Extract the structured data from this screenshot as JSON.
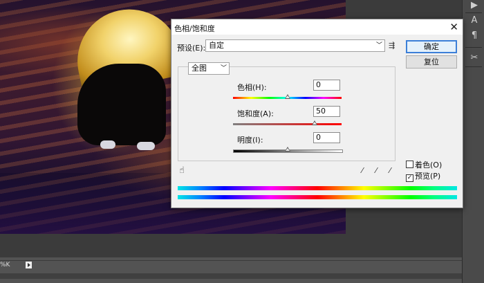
{
  "dialog": {
    "title": "色相/饱和度",
    "close_glyph": "✕",
    "preset_label": "预设(E):",
    "preset_value": "自定",
    "preset_menu_glyph": "⇶",
    "channel_value": "全图",
    "ok_label": "确定",
    "reset_label": "复位",
    "colorize_label": "着色(O)",
    "preview_label": "预览(P)",
    "preview_checked": true,
    "colorize_checked": false
  },
  "sliders": [
    {
      "label": "色相(H):",
      "value": "0",
      "fraction": 0.5,
      "track": "hue"
    },
    {
      "label": "饱和度(A):",
      "value": "50",
      "fraction": 0.75,
      "track": "saturation"
    },
    {
      "label": "明度(I):",
      "value": "0",
      "fraction": 0.5,
      "track": "lightness"
    }
  ],
  "status": {
    "zoom_text": "%K"
  },
  "icons": {
    "hand": "hand-icon",
    "eyedroppers": [
      "eyedropper-icon",
      "eyedropper-plus-icon",
      "eyedropper-minus-icon"
    ]
  },
  "colors": {
    "accent": "#3c7fd8",
    "dialog_bg": "#f0f0f0",
    "workspace_bg": "#3b3b3b"
  }
}
